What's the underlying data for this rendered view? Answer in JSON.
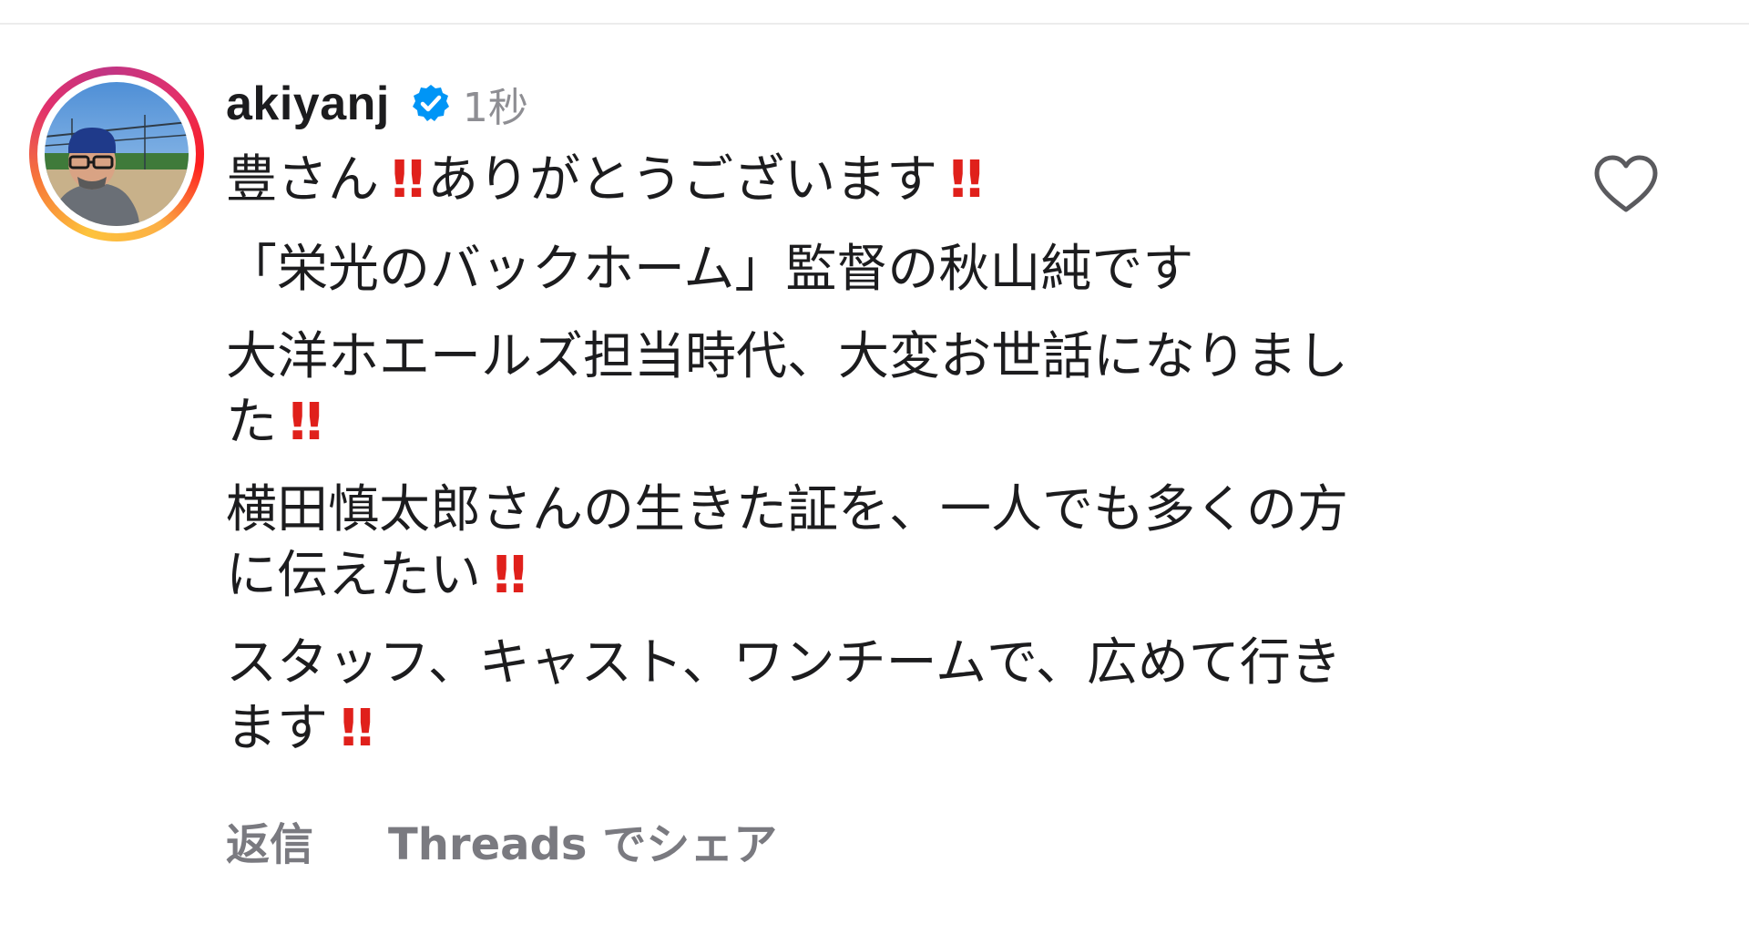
{
  "comment": {
    "username": "akiyanj",
    "verified_icon": "verified-badge-icon",
    "timestamp": "1秒",
    "lines": {
      "l1_a": "豊さん",
      "l1_b": "ありがとうございます",
      "l2": "「栄光のバックホーム」監督の秋山純です",
      "l3": "大洋ホエールズ担当時代、大変お世話になりまし",
      "l4": "た",
      "l5": "横田慎太郎さんの生きた証を、一人でも多くの方",
      "l6": "に伝えたい",
      "l7": "スタッフ、キャスト、ワンチームで、広めて行き",
      "l8": "ます"
    },
    "emphasis_glyph": "‼",
    "emphasis_color": "#e0201b",
    "like_icon": "heart-outline-icon",
    "actions": {
      "reply": "返信",
      "share_threads": "Threads でシェア"
    }
  },
  "colors": {
    "verified_blue": "#0095f6",
    "secondary_text": "#8e8e93",
    "action_text": "#7a7a80",
    "primary_text": "#1c1c1e"
  }
}
